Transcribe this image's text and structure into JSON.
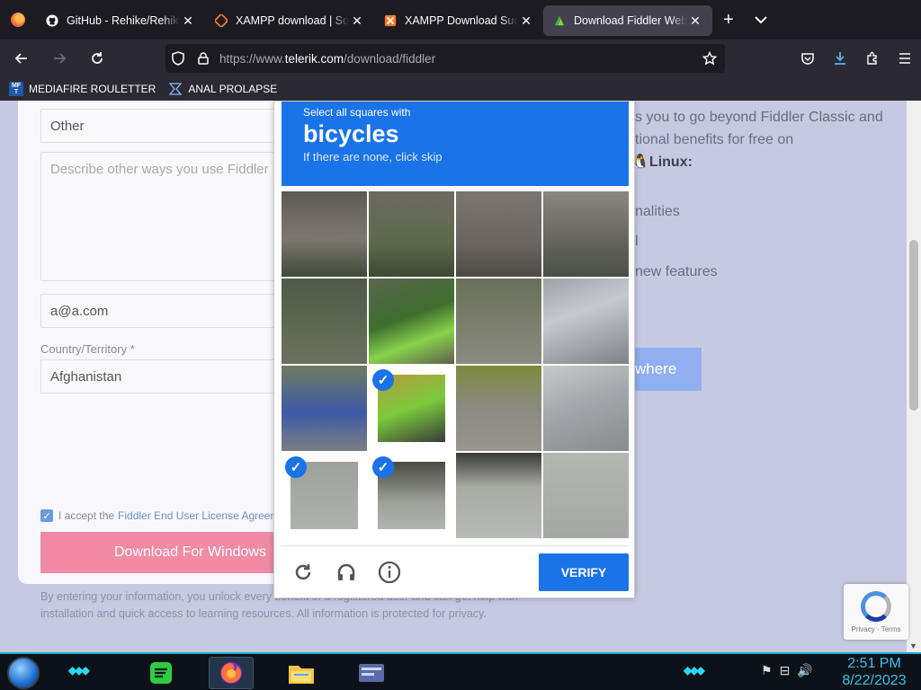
{
  "tabs": [
    {
      "title": "GitHub - Rehike/Rehike",
      "icon": "github-icon"
    },
    {
      "title": "XAMPP download | SourceForge",
      "icon": "xampp-icon"
    },
    {
      "title": "XAMPP Download Success",
      "icon": "xampp-icon"
    },
    {
      "title": "Download Fiddler Web Debugging",
      "icon": "fiddler-icon",
      "active": true
    }
  ],
  "url": {
    "prefix": "https://www.",
    "domain": "telerik.com",
    "path": "/download/fiddler"
  },
  "bookmarks": [
    {
      "label": "MEDIAFIRE ROULETTER",
      "icon_text": "MF T"
    },
    {
      "label": "ANAL PROLAPSE"
    }
  ],
  "form": {
    "usage_select": "Other",
    "usage_textarea_placeholder": "Describe other ways you use Fiddler",
    "email_value": "a@a.com",
    "country_label": "Country/Territory *",
    "country_value": "Afghanistan",
    "accept_text": "I accept the",
    "accept_link": "Fiddler End User License Agreement",
    "download_button": "Download For Windows",
    "fineprint": "By entering your information, you unlock every benefit of a registered user and can get help with installation and quick access to learning resources. All information is protected for privacy."
  },
  "right_copy": {
    "line1": "s you to go beyond Fiddler Classic and",
    "line2": "tional benefits for free on",
    "linux": "Linux",
    "linux_suffix": ":",
    "feature1": "nalities",
    "feature2": "l",
    "feature3": "new features",
    "button": "where"
  },
  "captcha": {
    "instruction": "Select all squares with",
    "target": "bicycles",
    "hint": "If there are none, click skip",
    "selected_tiles": [
      9,
      12,
      13
    ],
    "verify_label": "VERIFY"
  },
  "recaptcha_badge": {
    "links": "Privacy - Terms"
  },
  "taskbar": {
    "time": "2:51 PM",
    "date": "8/22/2023"
  },
  "colors": {
    "captcha_blue": "#1a73e8",
    "download_pink": "#f08aa5",
    "taskbar_accent": "#26a7c6"
  }
}
